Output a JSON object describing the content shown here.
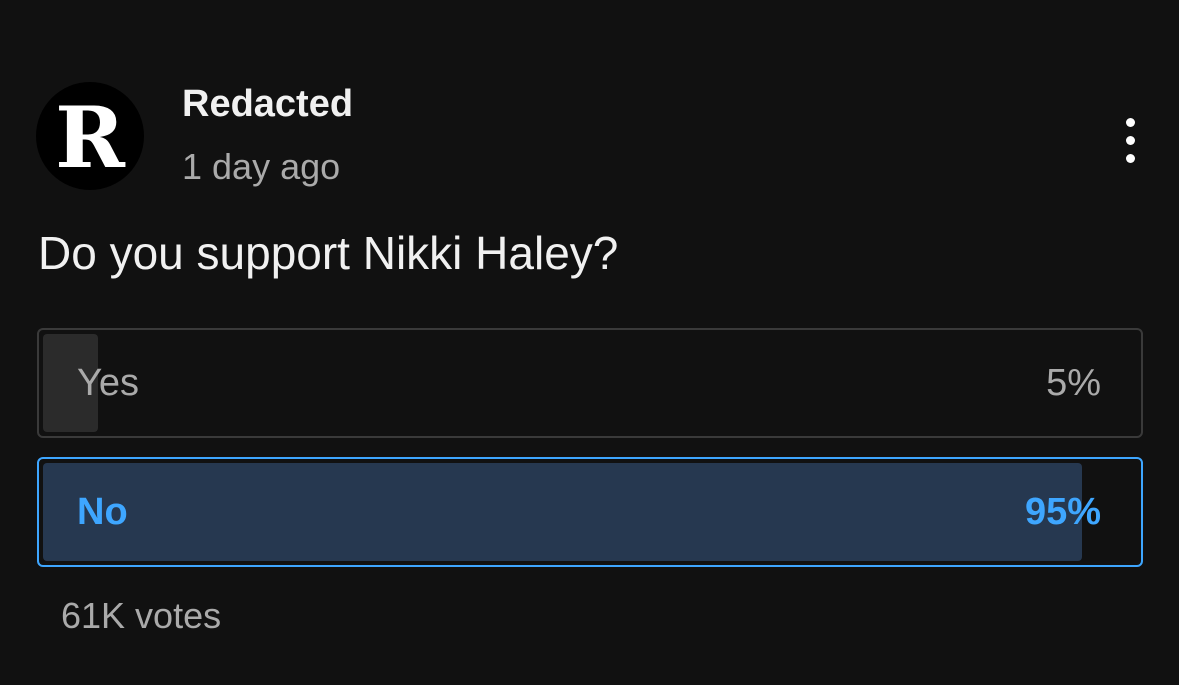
{
  "channel": {
    "avatar_letter": "R",
    "name": "Redacted",
    "posted": "1 day ago"
  },
  "menu": {
    "icon": "vertical-ellipsis-icon"
  },
  "poll": {
    "question": "Do you support Nikki Haley?",
    "options": [
      {
        "label": "Yes",
        "percent_text": "5%",
        "percent": 5,
        "selected": false
      },
      {
        "label": "No",
        "percent_text": "95%",
        "percent": 95,
        "selected": true
      }
    ],
    "votes": "61K votes"
  },
  "colors": {
    "background": "#111111",
    "accent": "#3ea6ff",
    "selected_fill": "#263850",
    "unselected_fill": "#2b2b2b",
    "muted_text": "#aaaaaa"
  }
}
